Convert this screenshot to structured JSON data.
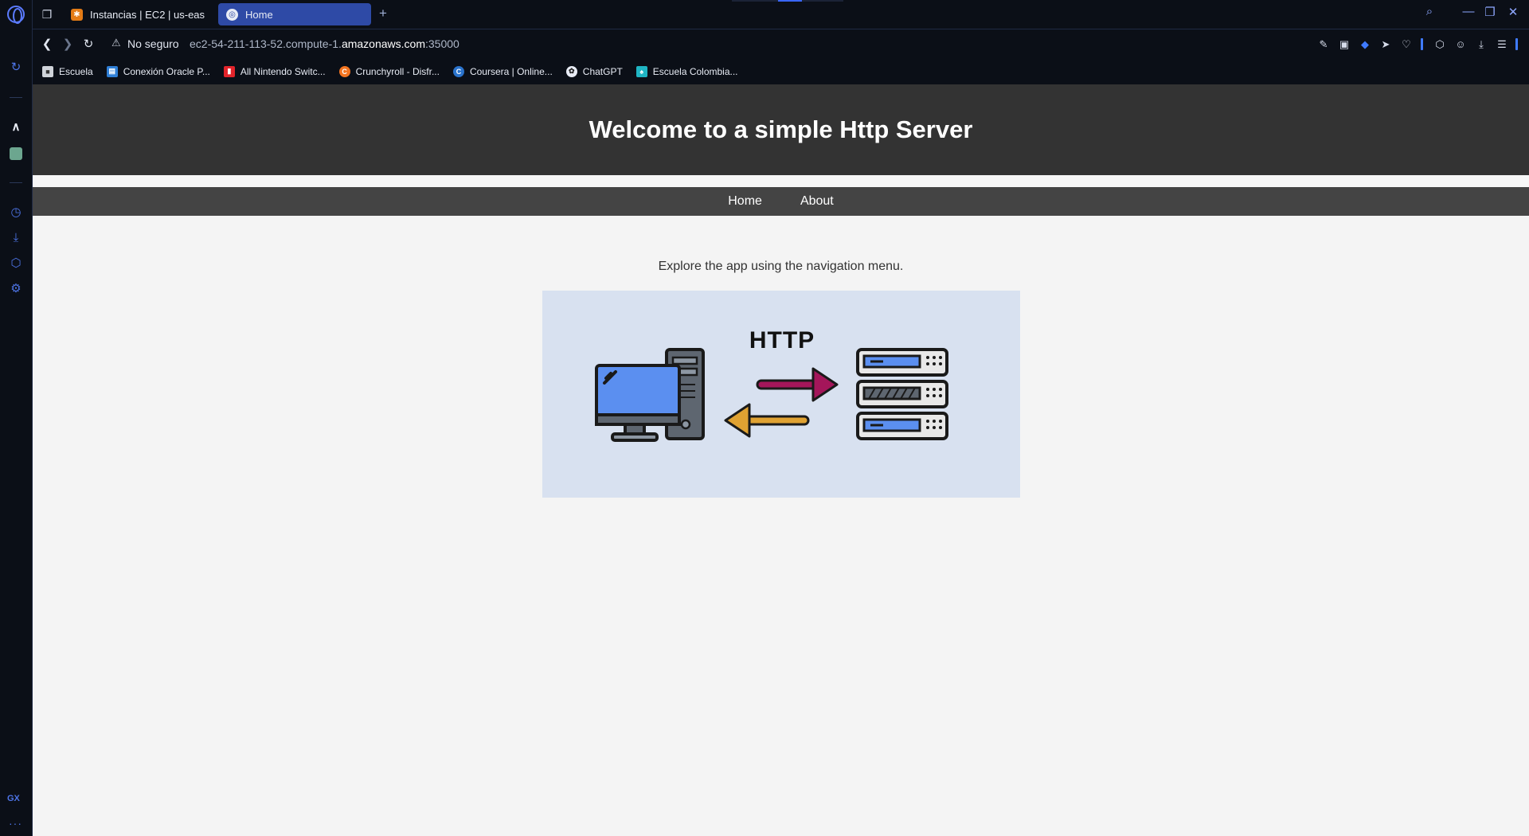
{
  "browser": {
    "tabs": [
      {
        "label": "Instancias | EC2 | us-east-",
        "active": false,
        "icon": "aws-icon"
      },
      {
        "label": "Home",
        "active": true,
        "icon": "globe-icon"
      }
    ],
    "address": {
      "security_label": "No seguro",
      "url_prefix": "ec2-54-211-113-52.compute-1.",
      "url_domain": "amazonaws.com",
      "url_suffix": ":35000"
    },
    "bookmarks": [
      {
        "label": "Escuela",
        "color": "#d0d4da"
      },
      {
        "label": "Conexión Oracle P...",
        "color": "#2f7fd6"
      },
      {
        "label": "All Nintendo Switc...",
        "color": "#e3242b"
      },
      {
        "label": "Crunchyroll - Disfr...",
        "color": "#f47521"
      },
      {
        "label": "Coursera | Online...",
        "color": "#2a73cc"
      },
      {
        "label": "ChatGPT",
        "color": "#e8ecf5"
      },
      {
        "label": "Escuela Colombia...",
        "color": "#1fb5c4"
      }
    ],
    "accent_color": "#3f7bff"
  },
  "page": {
    "title": "Welcome to a simple Http Server",
    "nav": {
      "home": "Home",
      "about": "About"
    },
    "intro": "Explore the app using the navigation menu.",
    "illustration": {
      "label": "HTTP"
    }
  }
}
